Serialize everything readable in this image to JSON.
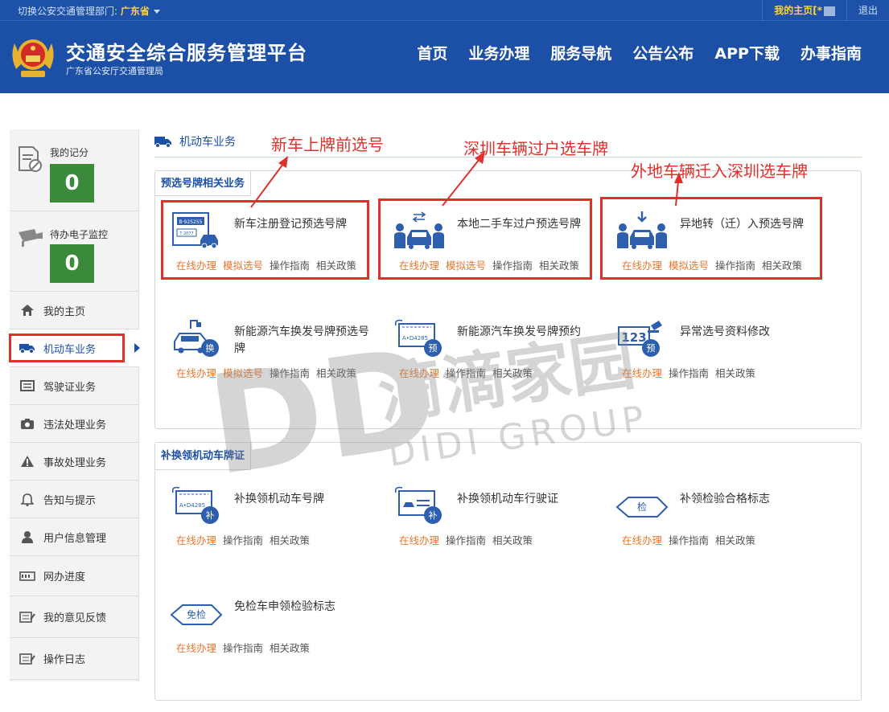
{
  "topbar": {
    "dept_label": "切换公安交通管理部门:",
    "dept_value": "广东省",
    "my_home": "我的主页[*",
    "logout": "退出"
  },
  "header": {
    "title": "交通安全综合服务管理平台",
    "subtitle": "广东省公安厅交通管理局",
    "nav": [
      "首页",
      "业务办理",
      "服务导航",
      "公告公布",
      "APP下载",
      "办事指南"
    ]
  },
  "sidebar": {
    "score_label": "我的记分",
    "score_value": "0",
    "monitor_label": "待办电子监控",
    "monitor_value": "0",
    "items": [
      "我的主页",
      "机动车业务",
      "驾驶证业务",
      "违法处理业务",
      "事故处理业务",
      "告知与提示",
      "用户信息管理",
      "网办进度",
      "我的意见反馈",
      "操作日志"
    ]
  },
  "main": {
    "heading": "机动车业务",
    "panel1_title": "预选号牌相关业务",
    "panel2_title": "补换领机动车牌证",
    "links": {
      "online": "在线办理",
      "simulate": "模拟选号",
      "guide": "操作指南",
      "policy": "相关政策"
    },
    "services1": [
      {
        "title": "新车注册登记预选号牌",
        "icon": "new-plate-icon",
        "plate_a": "B·925255",
        "plate_b": "T·2077"
      },
      {
        "title": "本地二手车过户预选号牌",
        "icon": "transfer-icon"
      },
      {
        "title": "异地转（迁）入预选号牌",
        "icon": "move-in-icon"
      },
      {
        "title": "新能源汽车换发号牌预选号牌",
        "icon": "ev-change-icon",
        "badge": "换"
      },
      {
        "title": "新能源汽车换发号牌预约",
        "icon": "ev-appointment-icon",
        "badge": "预",
        "plate": "A•D4285"
      },
      {
        "title": "异常选号资料修改",
        "icon": "abnormal-edit-icon",
        "badge": "预",
        "number": "123"
      }
    ],
    "services2": [
      {
        "title": "补换领机动车号牌",
        "icon": "plate-replace-icon",
        "badge": "补",
        "plate": "A•D4285"
      },
      {
        "title": "补换领机动车行驶证",
        "icon": "license-replace-icon",
        "badge": "补"
      },
      {
        "title": "补领检验合格标志",
        "icon": "inspection-mark-icon",
        "badge": "检"
      },
      {
        "title": "免检车申领检验标志",
        "icon": "exempt-mark-icon",
        "badge": "免检"
      }
    ]
  },
  "annotations": [
    "新车上牌前选号",
    "深圳车辆过户选车牌",
    "外地车辆迁入深圳选车牌"
  ],
  "watermark": {
    "letters": "DD",
    "cn": "滴滴家园",
    "en": "DIDI GROUP"
  },
  "colors": {
    "header": "#1c4fa6",
    "accent": "#e8772e",
    "score": "#3b8a3b",
    "annotation": "#e0302c"
  }
}
